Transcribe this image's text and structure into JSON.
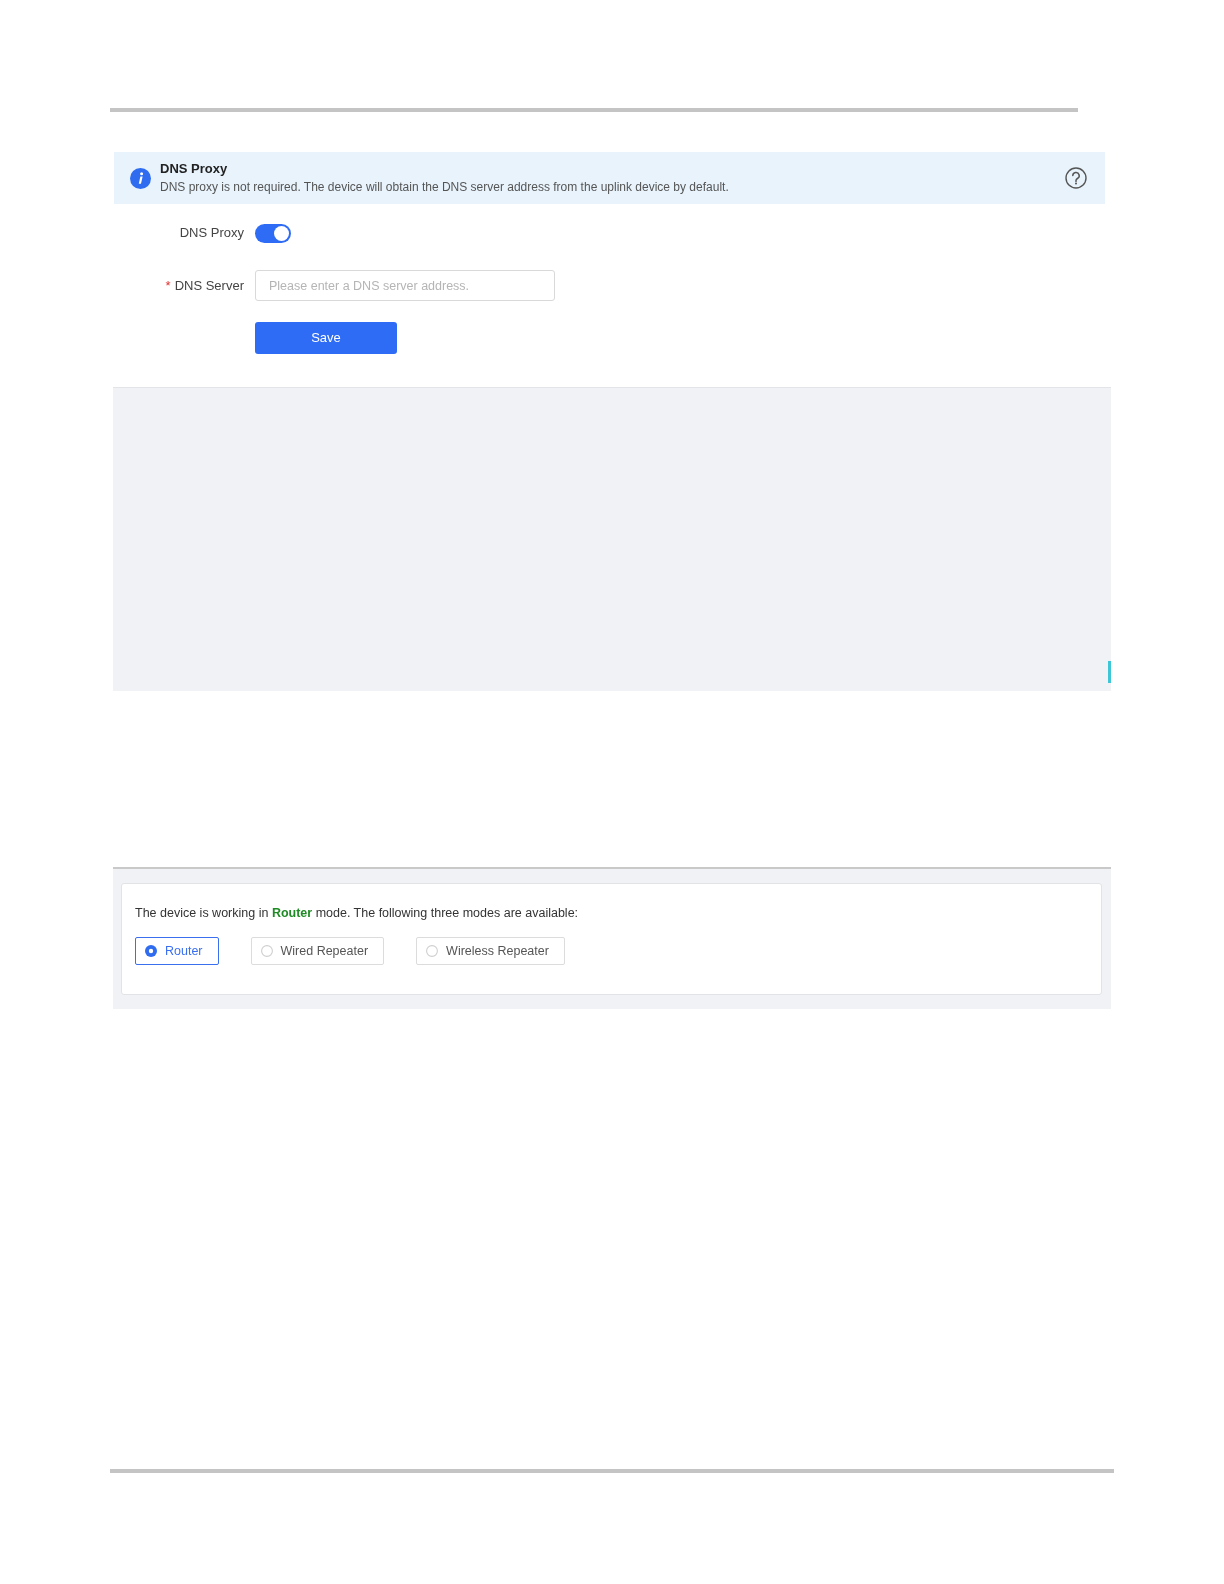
{
  "dns_proxy_screen": {
    "alert": {
      "title": "DNS Proxy",
      "message": "DNS proxy is not required. The device will obtain the DNS server address from the uplink device by default."
    },
    "dns_proxy": {
      "label": "DNS Proxy",
      "on": true
    },
    "dns_server": {
      "required_mark": "*",
      "label": "DNS Server",
      "placeholder": "Please enter a DNS server address."
    },
    "save_button": "Save"
  },
  "work_mode_screen": {
    "status": "The device is working in **Router** mode. The following three modes are available:",
    "modes": [
      {
        "label": "Router",
        "selected": true
      },
      {
        "label": "Wired Repeater",
        "selected": false
      },
      {
        "label": "Wireless Repeater",
        "selected": false
      }
    ]
  }
}
